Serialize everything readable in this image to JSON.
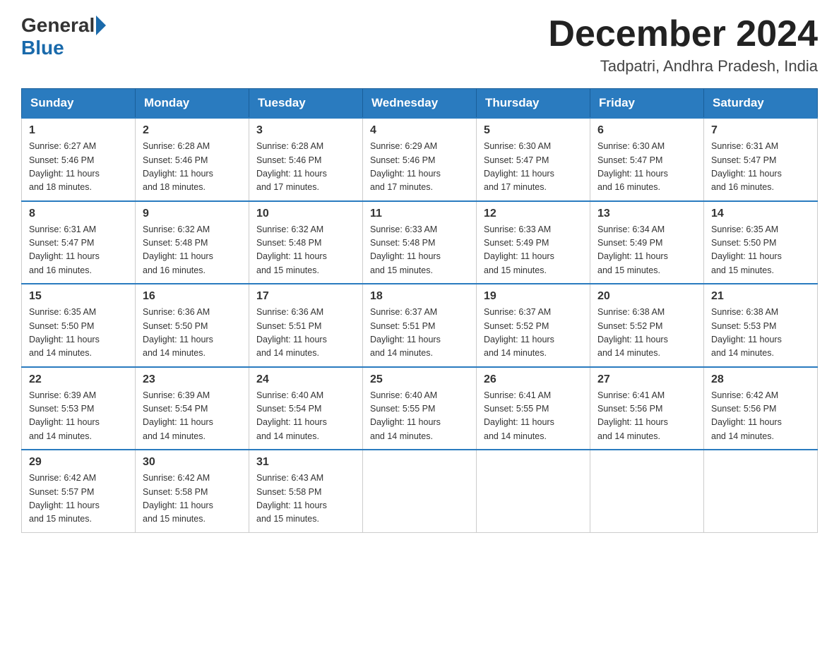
{
  "header": {
    "logo_general": "General",
    "logo_blue": "Blue",
    "month_title": "December 2024",
    "location": "Tadpatri, Andhra Pradesh, India"
  },
  "days_of_week": [
    "Sunday",
    "Monday",
    "Tuesday",
    "Wednesday",
    "Thursday",
    "Friday",
    "Saturday"
  ],
  "weeks": [
    [
      {
        "day": "1",
        "sunrise": "6:27 AM",
        "sunset": "5:46 PM",
        "daylight": "11 hours and 18 minutes."
      },
      {
        "day": "2",
        "sunrise": "6:28 AM",
        "sunset": "5:46 PM",
        "daylight": "11 hours and 18 minutes."
      },
      {
        "day": "3",
        "sunrise": "6:28 AM",
        "sunset": "5:46 PM",
        "daylight": "11 hours and 17 minutes."
      },
      {
        "day": "4",
        "sunrise": "6:29 AM",
        "sunset": "5:46 PM",
        "daylight": "11 hours and 17 minutes."
      },
      {
        "day": "5",
        "sunrise": "6:30 AM",
        "sunset": "5:47 PM",
        "daylight": "11 hours and 17 minutes."
      },
      {
        "day": "6",
        "sunrise": "6:30 AM",
        "sunset": "5:47 PM",
        "daylight": "11 hours and 16 minutes."
      },
      {
        "day": "7",
        "sunrise": "6:31 AM",
        "sunset": "5:47 PM",
        "daylight": "11 hours and 16 minutes."
      }
    ],
    [
      {
        "day": "8",
        "sunrise": "6:31 AM",
        "sunset": "5:47 PM",
        "daylight": "11 hours and 16 minutes."
      },
      {
        "day": "9",
        "sunrise": "6:32 AM",
        "sunset": "5:48 PM",
        "daylight": "11 hours and 16 minutes."
      },
      {
        "day": "10",
        "sunrise": "6:32 AM",
        "sunset": "5:48 PM",
        "daylight": "11 hours and 15 minutes."
      },
      {
        "day": "11",
        "sunrise": "6:33 AM",
        "sunset": "5:48 PM",
        "daylight": "11 hours and 15 minutes."
      },
      {
        "day": "12",
        "sunrise": "6:33 AM",
        "sunset": "5:49 PM",
        "daylight": "11 hours and 15 minutes."
      },
      {
        "day": "13",
        "sunrise": "6:34 AM",
        "sunset": "5:49 PM",
        "daylight": "11 hours and 15 minutes."
      },
      {
        "day": "14",
        "sunrise": "6:35 AM",
        "sunset": "5:50 PM",
        "daylight": "11 hours and 15 minutes."
      }
    ],
    [
      {
        "day": "15",
        "sunrise": "6:35 AM",
        "sunset": "5:50 PM",
        "daylight": "11 hours and 14 minutes."
      },
      {
        "day": "16",
        "sunrise": "6:36 AM",
        "sunset": "5:50 PM",
        "daylight": "11 hours and 14 minutes."
      },
      {
        "day": "17",
        "sunrise": "6:36 AM",
        "sunset": "5:51 PM",
        "daylight": "11 hours and 14 minutes."
      },
      {
        "day": "18",
        "sunrise": "6:37 AM",
        "sunset": "5:51 PM",
        "daylight": "11 hours and 14 minutes."
      },
      {
        "day": "19",
        "sunrise": "6:37 AM",
        "sunset": "5:52 PM",
        "daylight": "11 hours and 14 minutes."
      },
      {
        "day": "20",
        "sunrise": "6:38 AM",
        "sunset": "5:52 PM",
        "daylight": "11 hours and 14 minutes."
      },
      {
        "day": "21",
        "sunrise": "6:38 AM",
        "sunset": "5:53 PM",
        "daylight": "11 hours and 14 minutes."
      }
    ],
    [
      {
        "day": "22",
        "sunrise": "6:39 AM",
        "sunset": "5:53 PM",
        "daylight": "11 hours and 14 minutes."
      },
      {
        "day": "23",
        "sunrise": "6:39 AM",
        "sunset": "5:54 PM",
        "daylight": "11 hours and 14 minutes."
      },
      {
        "day": "24",
        "sunrise": "6:40 AM",
        "sunset": "5:54 PM",
        "daylight": "11 hours and 14 minutes."
      },
      {
        "day": "25",
        "sunrise": "6:40 AM",
        "sunset": "5:55 PM",
        "daylight": "11 hours and 14 minutes."
      },
      {
        "day": "26",
        "sunrise": "6:41 AM",
        "sunset": "5:55 PM",
        "daylight": "11 hours and 14 minutes."
      },
      {
        "day": "27",
        "sunrise": "6:41 AM",
        "sunset": "5:56 PM",
        "daylight": "11 hours and 14 minutes."
      },
      {
        "day": "28",
        "sunrise": "6:42 AM",
        "sunset": "5:56 PM",
        "daylight": "11 hours and 14 minutes."
      }
    ],
    [
      {
        "day": "29",
        "sunrise": "6:42 AM",
        "sunset": "5:57 PM",
        "daylight": "11 hours and 15 minutes."
      },
      {
        "day": "30",
        "sunrise": "6:42 AM",
        "sunset": "5:58 PM",
        "daylight": "11 hours and 15 minutes."
      },
      {
        "day": "31",
        "sunrise": "6:43 AM",
        "sunset": "5:58 PM",
        "daylight": "11 hours and 15 minutes."
      },
      null,
      null,
      null,
      null
    ]
  ],
  "labels": {
    "sunrise": "Sunrise:",
    "sunset": "Sunset:",
    "daylight": "Daylight:"
  }
}
